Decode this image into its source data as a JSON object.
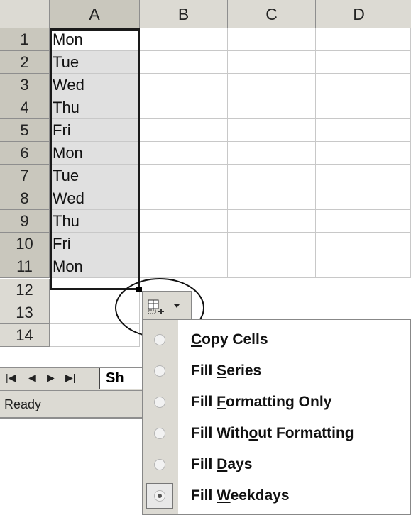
{
  "columns": [
    "A",
    "B",
    "C",
    "D"
  ],
  "rows": [
    {
      "num": "1",
      "value": "Mon"
    },
    {
      "num": "2",
      "value": "Tue"
    },
    {
      "num": "3",
      "value": "Wed"
    },
    {
      "num": "4",
      "value": "Thu"
    },
    {
      "num": "5",
      "value": "Fri"
    },
    {
      "num": "6",
      "value": "Mon"
    },
    {
      "num": "7",
      "value": "Tue"
    },
    {
      "num": "8",
      "value": "Wed"
    },
    {
      "num": "9",
      "value": "Thu"
    },
    {
      "num": "10",
      "value": "Fri"
    },
    {
      "num": "11",
      "value": "Mon"
    },
    {
      "num": "12",
      "value": ""
    },
    {
      "num": "13",
      "value": ""
    },
    {
      "num": "14",
      "value": ""
    }
  ],
  "sheet_tab": {
    "label": "Sh"
  },
  "status": {
    "text": "Ready"
  },
  "autofill_button": {
    "icon": "autofill-options-icon",
    "arrow": "▼"
  },
  "menu": {
    "items": [
      {
        "pre": "",
        "key": "C",
        "post": "opy Cells",
        "checked": false
      },
      {
        "pre": "Fill ",
        "key": "S",
        "post": "eries",
        "checked": false
      },
      {
        "pre": "Fill ",
        "key": "F",
        "post": "ormatting Only",
        "checked": false
      },
      {
        "pre": "Fill With",
        "key": "o",
        "post": "ut Formatting",
        "checked": false
      },
      {
        "pre": "Fill ",
        "key": "D",
        "post": "ays",
        "checked": false
      },
      {
        "pre": "Fill ",
        "key": "W",
        "post": "eekdays",
        "checked": true
      }
    ]
  }
}
